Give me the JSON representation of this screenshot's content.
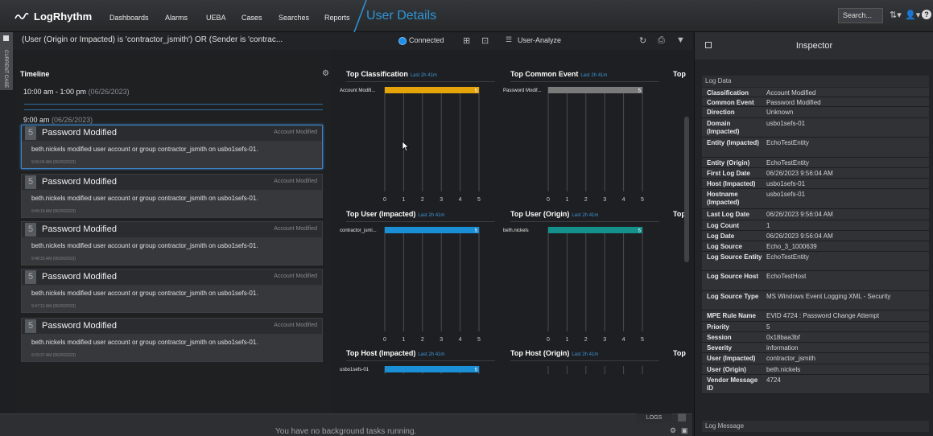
{
  "app": {
    "brand": "LogRhythm",
    "nav": [
      "Dashboards",
      "Alarms",
      "UEBA",
      "Cases",
      "Searches",
      "Reports"
    ],
    "page_title": "User Details",
    "search_placeholder": "Search..."
  },
  "query": {
    "text": "(User (Origin or Impacted) is 'contractor_jsmith') OR (Sender is 'contrac...",
    "connection_status": "Connected",
    "layout_name": "User-Analyze"
  },
  "case_strip": {
    "label": "CURRENT CASE"
  },
  "timeline": {
    "title": "Timeline",
    "ranges": [
      {
        "time": "10:00 am - 1:00 pm",
        "date": "(06/26/2023)"
      },
      {
        "time": "9:00 am",
        "date": "(06/26/2023)"
      }
    ],
    "events": [
      {
        "count": "5",
        "title": "Password Modified",
        "classification": "Account Modified",
        "description": "beth.nickels modified user account or group contractor_jsmith on usbo1sefs-01.",
        "timestamp": "9:56:04 AM (06/26/2023)"
      },
      {
        "count": "5",
        "title": "Password Modified",
        "classification": "Account Modified",
        "description": "beth.nickels modified user account or group contractor_jsmith on usbo1sefs-01.",
        "timestamp": "9:49:19 AM (06/26/2023)"
      },
      {
        "count": "5",
        "title": "Password Modified",
        "classification": "Account Modified",
        "description": "beth.nickels modified user account or group contractor_jsmith on usbo1sefs-01.",
        "timestamp": "9:48:33 AM (06/26/2023)"
      },
      {
        "count": "5",
        "title": "Password Modified",
        "classification": "Account Modified",
        "description": "beth.nickels modified user account or group contractor_jsmith on usbo1sefs-01.",
        "timestamp": "9:47:12 AM (06/26/2023)"
      },
      {
        "count": "5",
        "title": "Password Modified",
        "classification": "Account Modified",
        "description": "beth.nickels modified user account or group contractor_jsmith on usbo1sefs-01.",
        "timestamp": "9:29:37 AM (06/26/2023)"
      }
    ]
  },
  "widgets": {
    "range_label": "Last 2h 41m",
    "top_col_label": "Top"
  },
  "chart_data": [
    {
      "type": "bar",
      "title": "Top Classification",
      "categories": [
        "Account Modifi..."
      ],
      "values": [
        5
      ],
      "color": "#e5a50a",
      "xlim": [
        0,
        5
      ],
      "xticks": [
        "0",
        "1",
        "2",
        "3",
        "4",
        "5"
      ]
    },
    {
      "type": "bar",
      "title": "Top Common Event",
      "categories": [
        "Password Modif..."
      ],
      "values": [
        5
      ],
      "color": "#7a7a7a",
      "xlim": [
        0,
        5
      ],
      "xticks": [
        "0",
        "1",
        "2",
        "3",
        "4",
        "5"
      ]
    },
    {
      "type": "bar",
      "title": "Top User (Impacted)",
      "categories": [
        "contractor_jsmi..."
      ],
      "values": [
        5
      ],
      "color": "#1a8fd6",
      "xlim": [
        0,
        5
      ],
      "xticks": [
        "0",
        "1",
        "2",
        "3",
        "4",
        "5"
      ]
    },
    {
      "type": "bar",
      "title": "Top User (Origin)",
      "categories": [
        "beth.nickels"
      ],
      "values": [
        5
      ],
      "color": "#15918c",
      "xlim": [
        0,
        5
      ],
      "xticks": [
        "0",
        "1",
        "2",
        "3",
        "4",
        "5"
      ]
    },
    {
      "type": "bar",
      "title": "Top Host (Impacted)",
      "categories": [
        "usbo1sefs-01"
      ],
      "values": [
        5
      ],
      "color": "#1a8fd6",
      "xlim": [
        0,
        5
      ],
      "xticks": []
    },
    {
      "type": "bar",
      "title": "Top Host (Origin)",
      "categories": [],
      "values": [],
      "color": "#1a8fd6",
      "xlim": [
        0,
        5
      ],
      "xticks": []
    }
  ],
  "logs": {
    "tab_label": "LOGS",
    "status": "You have no background tasks running."
  },
  "inspector": {
    "title": "Inspector",
    "section_log_data": "Log Data",
    "section_log_message": "Log Message",
    "rows": [
      {
        "key": "Classification",
        "value": "Account Modified"
      },
      {
        "key": "Common Event",
        "value": "Password Modified"
      },
      {
        "key": "Direction",
        "value": "Unknown"
      },
      {
        "key": "Domain (Impacted)",
        "value": "usbo1sefs-01"
      },
      {
        "key": "Entity (Impacted)",
        "value": "EchoTestEntity"
      },
      {
        "key": "Entity (Origin)",
        "value": "EchoTestEntity"
      },
      {
        "key": "First Log Date",
        "value": "06/26/2023 9:56:04 AM"
      },
      {
        "key": "Host (Impacted)",
        "value": "usbo1sefs-01"
      },
      {
        "key": "Hostname (Impacted)",
        "value": "usbo1sefs-01"
      },
      {
        "key": "Last Log Date",
        "value": "06/26/2023 9:56:04 AM"
      },
      {
        "key": "Log Count",
        "value": "1"
      },
      {
        "key": "Log Date",
        "value": "06/26/2023 9:56:04 AM"
      },
      {
        "key": "Log Source",
        "value": "Echo_3_1000639"
      },
      {
        "key": "Log Source Entity",
        "value": "EchoTestEntity"
      },
      {
        "key": "Log Source Host",
        "value": "EchoTestHost"
      },
      {
        "key": "Log Source Type",
        "value": "MS Windows Event Logging XML - Security"
      },
      {
        "key": "MPE Rule Name",
        "value": "EVID 4724 : Password Change Attempt"
      },
      {
        "key": "Priority",
        "value": "5"
      },
      {
        "key": "Session",
        "value": "0x18baa3bf"
      },
      {
        "key": "Severity",
        "value": "information"
      },
      {
        "key": "User (Impacted)",
        "value": "contractor_jsmith"
      },
      {
        "key": "User (Origin)",
        "value": "beth.nickels"
      },
      {
        "key": "Vendor Message ID",
        "value": "4724"
      }
    ]
  }
}
